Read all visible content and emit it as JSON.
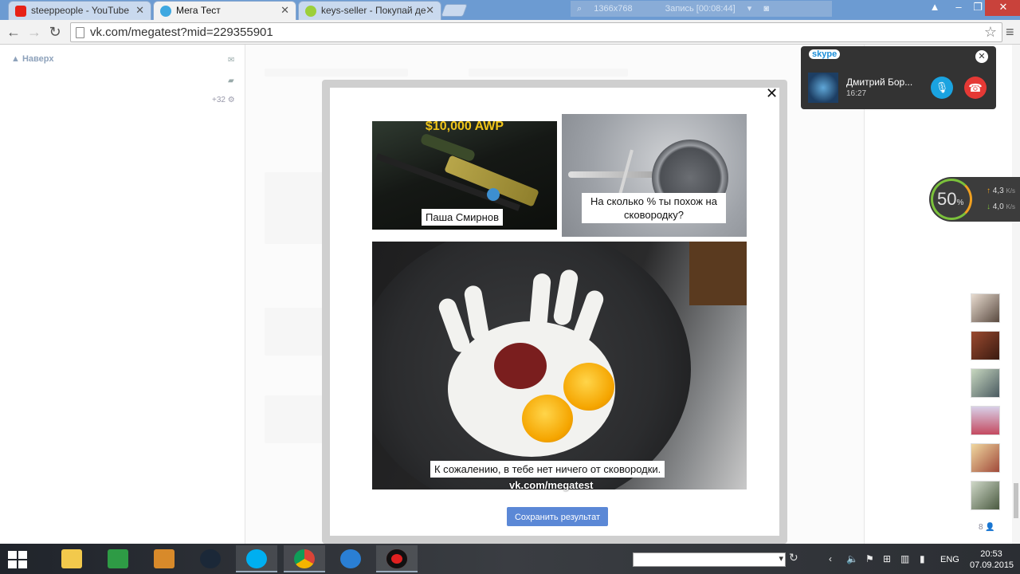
{
  "browser": {
    "tabs": [
      {
        "title": "steeppeople - YouTube",
        "icon": "youtube-icon",
        "icon_color": "#e62117"
      },
      {
        "title": "Мега Тест",
        "icon": "vk-app-icon",
        "icon_color": "#3fa8e0",
        "active": true
      },
      {
        "title": "keys-seller - Покупай де",
        "icon": "keys-seller-icon",
        "icon_color": "#9ccf3a"
      }
    ],
    "recording": {
      "resolution": "1366x768",
      "status": "Запись [00:08:44]"
    },
    "url": "vk.com/megatest?mid=229355901"
  },
  "vk": {
    "scroll_top_label": "Наверх",
    "notification_count": "+32",
    "friends_online_count": "8"
  },
  "modal": {
    "images": [
      {
        "title": "$10,000 AWP",
        "caption": "Паша Смирнов"
      },
      {
        "caption": "На сколько % ты похож на сковородку?"
      },
      {
        "caption": "К сожалению, в тебе нет ничего от сковородки.",
        "watermark": "vk.com/megatest"
      }
    ],
    "save_button": "Сохранить результат"
  },
  "skype": {
    "logo": "skype",
    "caller": "Дмитрий Бор...",
    "call_time": "16:27"
  },
  "network_widget": {
    "load_percent": "50",
    "percent_sign": "%",
    "upload": "4,3",
    "download": "4,0",
    "unit": "K/s"
  },
  "taskbar": {
    "apps": [
      "file-explorer",
      "windows-store",
      "cs-go",
      "steam",
      "skype",
      "chrome",
      "app-circles",
      "recorder"
    ],
    "language": "ENG",
    "time": "20:53",
    "date": "07.09.2015"
  },
  "colors": {
    "chrome_frame": "#6c9bd2",
    "vk_button": "#5b88d6",
    "skype_blue": "#1aa3e0",
    "hangup_red": "#e53935"
  }
}
